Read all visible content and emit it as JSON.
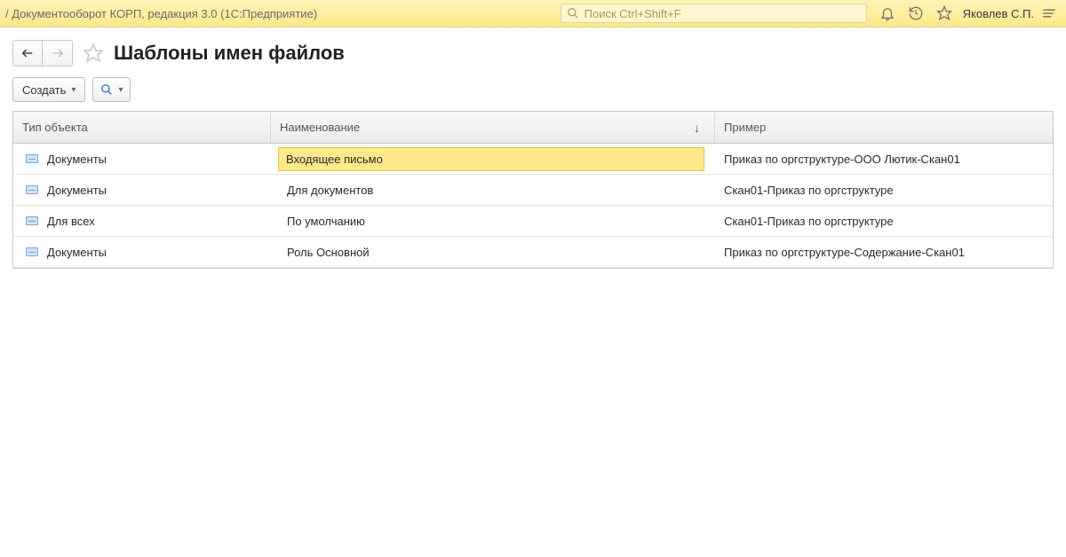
{
  "titlebar": {
    "app_title": "/ Документооборот КОРП, редакция 3.0  (1С:Предприятие)",
    "search_placeholder": "Поиск Ctrl+Shift+F",
    "user_name": "Яковлев С.П."
  },
  "page": {
    "title": "Шаблоны имен файлов"
  },
  "toolbar": {
    "create_label": "Создать"
  },
  "grid": {
    "columns": {
      "type": "Тип объекта",
      "name": "Наименование",
      "example": "Пример"
    },
    "rows": [
      {
        "type": "Документы",
        "name": "Входящее письмо",
        "example": "Приказ по оргструктуре-ООО Лютик-Скан01",
        "selected": true
      },
      {
        "type": "Документы",
        "name": "Для документов",
        "example": "Скан01-Приказ по оргструктуре",
        "selected": false
      },
      {
        "type": "Для всех",
        "name": "По умолчанию",
        "example": "Скан01-Приказ по оргструктуре",
        "selected": false
      },
      {
        "type": "Документы",
        "name": "Роль Основной",
        "example": "Приказ по оргструктуре-Содержание-Скан01",
        "selected": false
      }
    ]
  }
}
